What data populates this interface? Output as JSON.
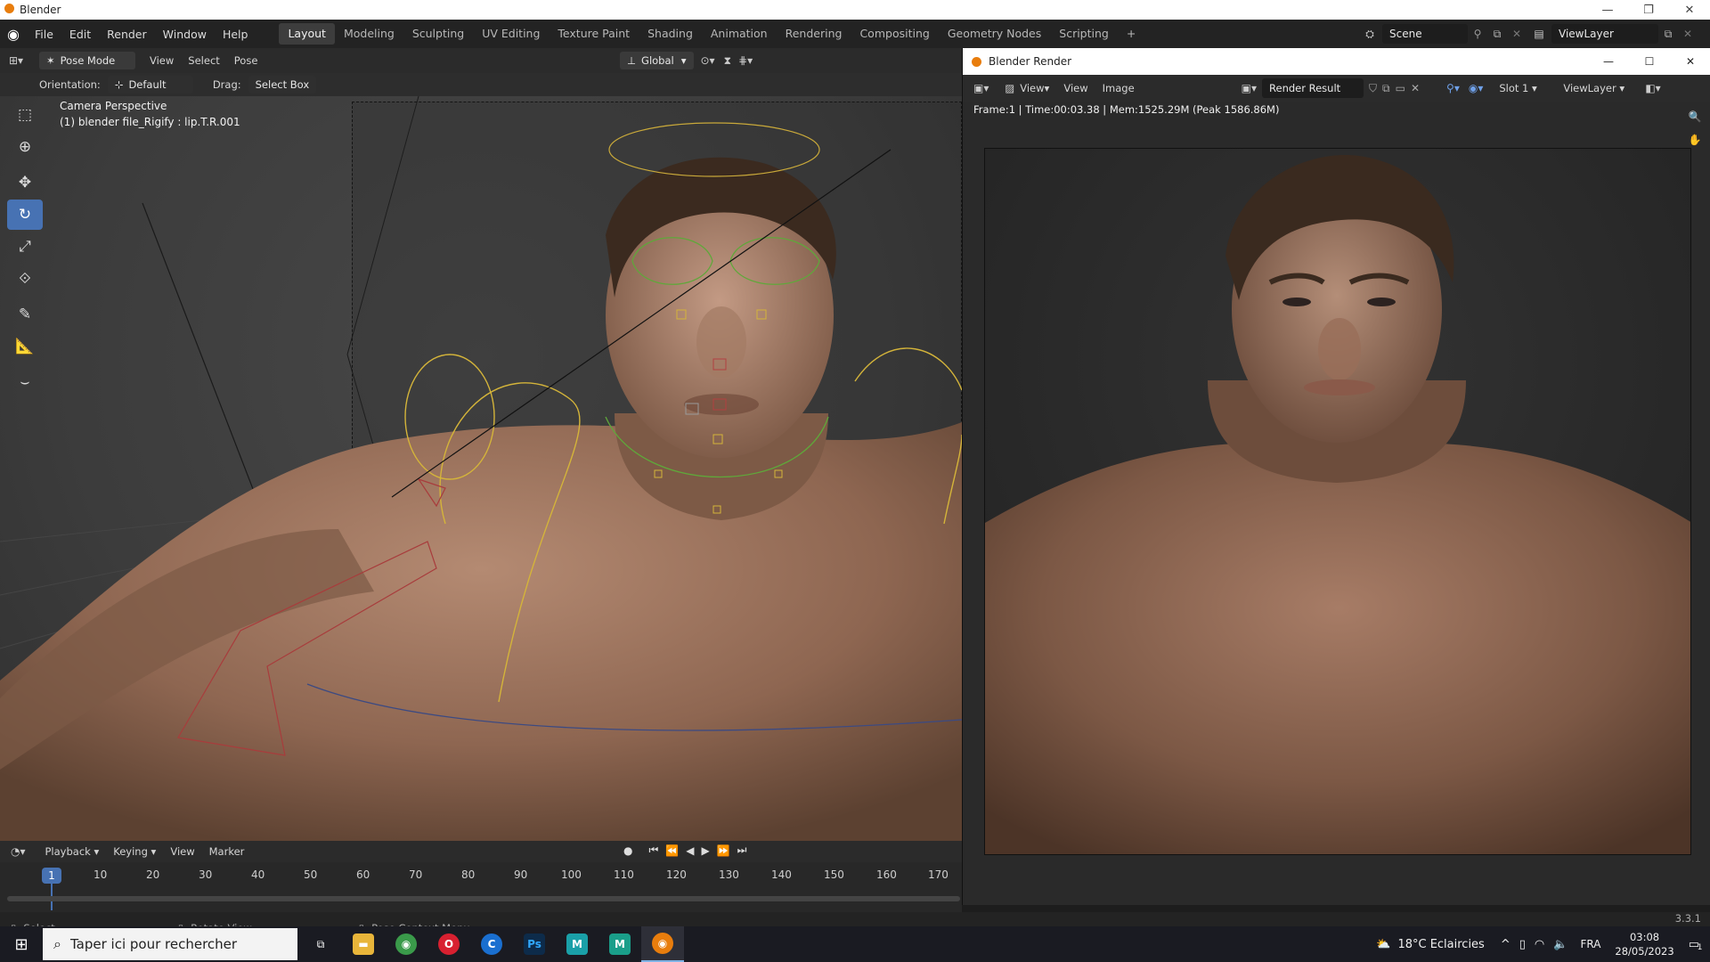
{
  "os_window": {
    "title": "Blender"
  },
  "menu": {
    "items": [
      "File",
      "Edit",
      "Render",
      "Window",
      "Help"
    ],
    "workspaces": [
      "Layout",
      "Modeling",
      "Sculpting",
      "UV Editing",
      "Texture Paint",
      "Shading",
      "Animation",
      "Rendering",
      "Compositing",
      "Geometry Nodes",
      "Scripting"
    ],
    "active_workspace": "Layout",
    "add_tab": "+",
    "scene": "Scene",
    "view_layer": "ViewLayer"
  },
  "viewport": {
    "mode": "Pose Mode",
    "menus": [
      "View",
      "Select",
      "Pose"
    ],
    "transform_orientation": "Global",
    "orientation_label": "Orientation:",
    "orientation_value": "Default",
    "drag_label": "Drag:",
    "drag_value": "Select Box",
    "overlay_line1": "Camera Perspective",
    "overlay_line2": "(1) blender file_Rigify : lip.T.R.001",
    "tools": [
      "select-box",
      "cursor",
      "move",
      "rotate",
      "scale",
      "transform",
      "annotate",
      "measure",
      "bone-tool"
    ],
    "active_tool": "rotate"
  },
  "timeline": {
    "menus": [
      "Playback",
      "Keying",
      "View",
      "Marker"
    ],
    "current_frame": "1",
    "ticks": [
      "10",
      "20",
      "30",
      "40",
      "50",
      "60",
      "70",
      "80",
      "90",
      "100",
      "110",
      "120",
      "130",
      "140",
      "150",
      "160",
      "170"
    ]
  },
  "render_window": {
    "title": "Blender Render",
    "menus": [
      "View",
      "View",
      "Image"
    ],
    "image_name": "Render Result",
    "slot": "Slot 1",
    "view_layer": "ViewLayer",
    "info": "Frame:1 | Time:00:03.38 | Mem:1525.29M (Peak 1586.86M)"
  },
  "statusbar": {
    "select": "Select",
    "rotate_view": "Rotate View",
    "context_menu": "Pose Context Menu",
    "version": "3.3.1"
  },
  "taskbar": {
    "search_placeholder": "Taper ici pour rechercher",
    "apps": [
      "task-view",
      "file-explorer",
      "chrome",
      "opera",
      "cortana",
      "photoshop",
      "maya",
      "mudbox",
      "blender"
    ],
    "weather": "18°C  Eclaircies",
    "language": "FRA",
    "time": "03:08",
    "date": "28/05/2023",
    "notifications": "1"
  },
  "colors": {
    "accent": "#4772b3",
    "rig_yellow": "#d4b43a",
    "rig_green": "#5fa83a",
    "rig_red": "#b24040"
  }
}
